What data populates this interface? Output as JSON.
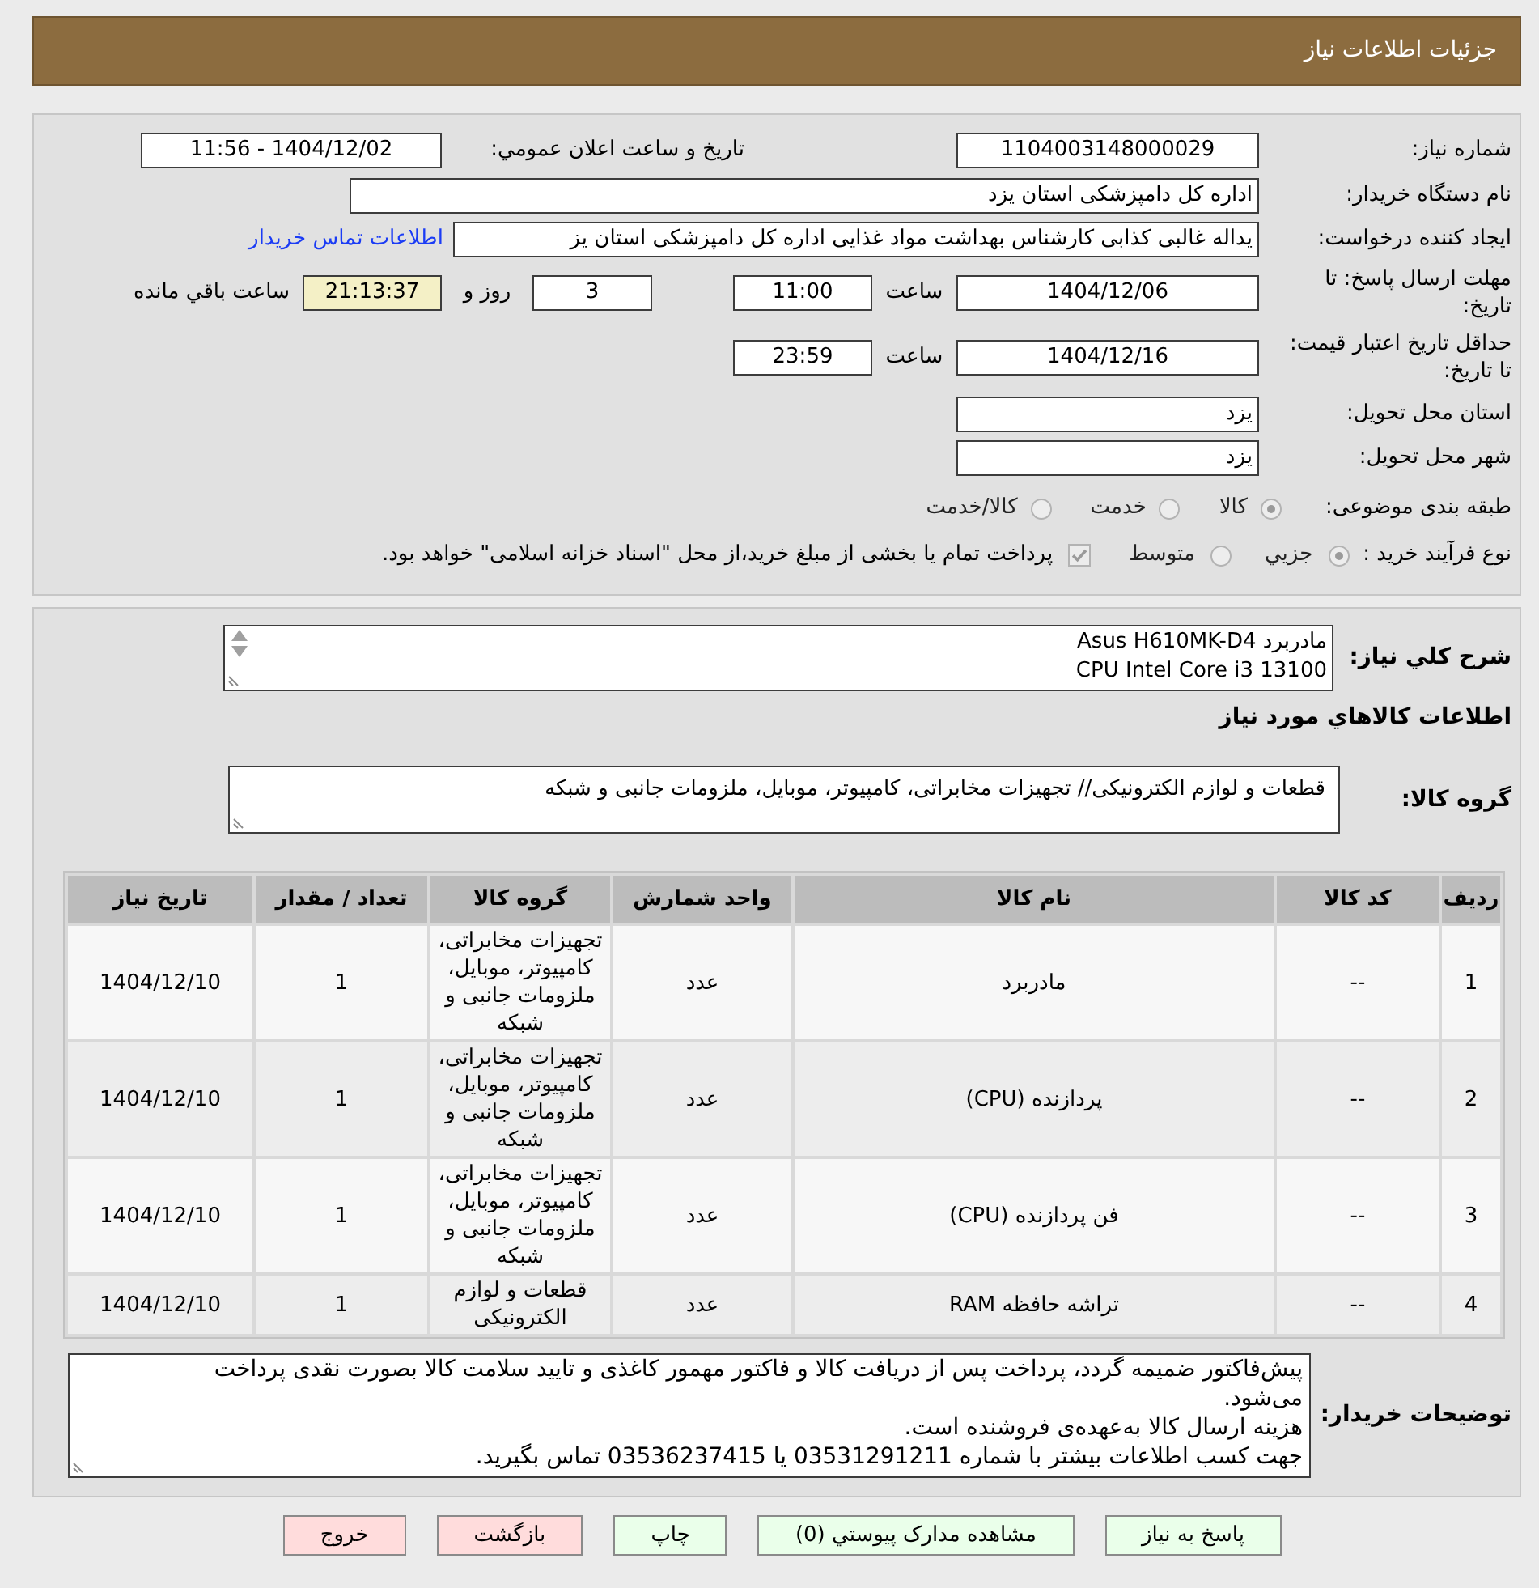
{
  "header": {
    "title": "جزئیات اطلاعات نیاز"
  },
  "need_details": {
    "need_number": {
      "label": "شماره نیاز:",
      "value": "1104003148000029"
    },
    "announcement": {
      "label": "تاریخ و ساعت اعلان عمومي:",
      "value": "1404/12/02 - 11:56"
    },
    "buyer_organization": {
      "label": "نام دستگاه خریدار:",
      "value": "اداره کل دامپزشکی استان یزد"
    },
    "requester": {
      "label": "ایجاد کننده درخواست:",
      "value": "یداله غالبی کذابی کارشناس بهداشت مواد غذایی اداره کل دامپزشکی استان یز",
      "contact_link": "اطلاعات تماس خریدار"
    },
    "response_deadline": {
      "label": "مهلت ارسال پاسخ: تا تاریخ:",
      "date": "1404/12/06",
      "time_label": "ساعت",
      "time": "11:00",
      "days": "3",
      "days_label": "روز و",
      "remaining": "21:13:37",
      "remaining_label": "ساعت باقي مانده"
    },
    "price_validity": {
      "label": "حداقل تاریخ اعتبار قیمت: تا تاریخ:",
      "date": "1404/12/16",
      "time_label": "ساعت",
      "time": "23:59"
    },
    "delivery_province": {
      "label": "استان محل تحویل:",
      "value": "یزد"
    },
    "delivery_city": {
      "label": "شهر محل تحویل:",
      "value": "یزد"
    },
    "subject_category": {
      "label": "طبقه بندی موضوعی:",
      "options": [
        {
          "label": "کالا",
          "selected": true
        },
        {
          "label": "خدمت",
          "selected": false
        },
        {
          "label": "کالا/خدمت",
          "selected": false
        }
      ]
    },
    "purchase_process": {
      "label": "نوع فرآیند خرید :",
      "options": [
        {
          "label": "جزيي",
          "selected": true
        },
        {
          "label": "متوسط",
          "selected": false
        }
      ],
      "treasury_payment": {
        "checked": true,
        "label": "پرداخت تمام یا بخشی از مبلغ خرید،از محل \"اسناد خزانه اسلامی\" خواهد بود."
      }
    }
  },
  "goods": {
    "summary": {
      "label": "شرح کلي نیاز:",
      "text": "مادربرد Asus H610MK-D4\nCPU Intel Core i3 13100"
    },
    "heading": "اطلاعات کالاهاي مورد نیاز",
    "group": {
      "label": "گروه کالا:",
      "value": "قطعات و لوازم الکترونیکی// تجهیزات مخابراتی، کامپیوتر، موبایل، ملزومات جانبی و شبکه"
    },
    "table": {
      "columns": [
        "ردیف",
        "کد کالا",
        "نام کالا",
        "واحد شمارش",
        "گروه کالا",
        "تعداد / مقدار",
        "تاریخ نیاز"
      ],
      "rows": [
        [
          "1",
          "--",
          "مادربرد",
          "عدد",
          "تجهیزات مخابراتی، کامپیوتر، موبایل، ملزومات جانبی و شبکه",
          "1",
          "1404/12/10"
        ],
        [
          "2",
          "--",
          "پردازنده (CPU)",
          "عدد",
          "تجهیزات مخابراتی، کامپیوتر، موبایل، ملزومات جانبی و شبکه",
          "1",
          "1404/12/10"
        ],
        [
          "3",
          "--",
          "فن پردازنده (CPU)",
          "عدد",
          "تجهیزات مخابراتی، کامپیوتر، موبایل، ملزومات جانبی و شبکه",
          "1",
          "1404/12/10"
        ],
        [
          "4",
          "--",
          "تراشه حافظه RAM",
          "عدد",
          "قطعات و لوازم الکترونیکی",
          "1",
          "1404/12/10"
        ]
      ]
    },
    "buyer_notes": {
      "label": "توضیحات خریدار:",
      "text": "پیش‌فاکتور ضمیمه گردد، پرداخت پس از دریافت کالا و فاکتور مهمور کاغذی و تایید سلامت کالا بصورت نقدی پرداخت می‌شود.\nهزینه ارسال کالا به‌عهده‌ی فروشنده است.\nجهت کسب اطلاعات بیشتر با شماره 03531291211 یا 03536237415 تماس بگیرید."
    }
  },
  "buttons": [
    {
      "label": "پاسخ به نیاز",
      "kind": "action"
    },
    {
      "label": "مشاهده مدارک پیوستي (0)",
      "kind": "action"
    },
    {
      "label": "چاپ",
      "kind": "action"
    },
    {
      "label": "بازگشت",
      "kind": "exit"
    },
    {
      "label": "خروج",
      "kind": "exit"
    }
  ]
}
